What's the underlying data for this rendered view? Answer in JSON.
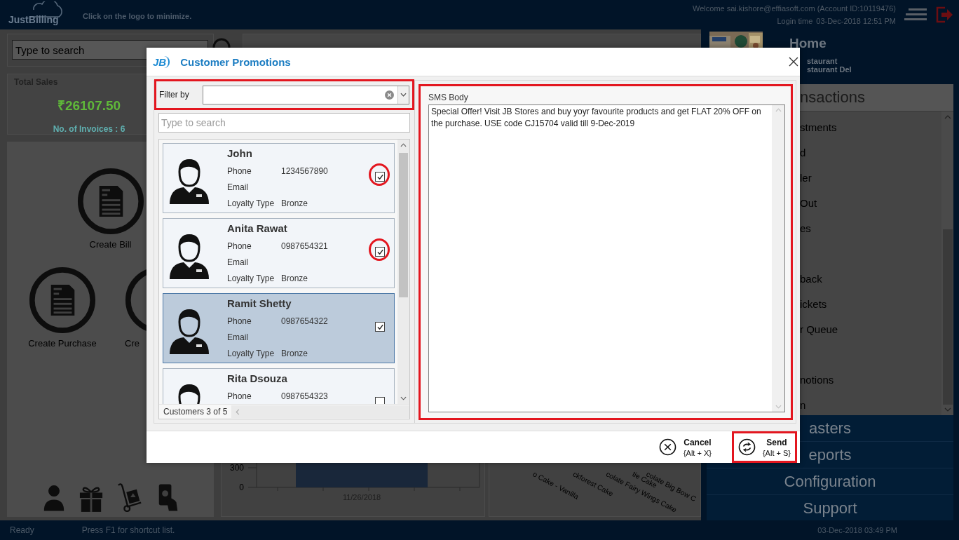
{
  "header": {
    "logo": "JustBilling",
    "hint": "Click on the logo to minimize.",
    "welcome": "Welcome sai.kishore@effiasoft.com (Account ID:10119476)",
    "login_label": "Login time",
    "login_time": "03-Dec-2018 12:51 PM"
  },
  "left_panel": {
    "search": {
      "placeholder": "Type to search"
    },
    "total_sales": {
      "title": "Total Sales",
      "amount": "₹26107.50",
      "invoices": "No. of Invoices : 6"
    },
    "actions": [
      {
        "label": "Create Bill"
      },
      {
        "label": "Create Purchase"
      },
      {
        "label": "Cre"
      }
    ]
  },
  "chart_fragment": {
    "ticks": [
      "300",
      "0"
    ],
    "category": "11/26/2018"
  },
  "product_labels": [
    "o Cake - Vanilla",
    "ckforest Cake",
    "colate Fairy Wings Cake",
    "tie Cake",
    "colate Big Bow C"
  ],
  "sidebar": {
    "home": "Home",
    "outlets": [
      "staurant",
      "staurant Del"
    ],
    "section": "nsactions",
    "items": [
      {
        "kind": "item",
        "label": "stments"
      },
      {
        "kind": "item",
        "label": "d"
      },
      {
        "kind": "item",
        "label": "ler"
      },
      {
        "kind": "item",
        "label": "Out"
      },
      {
        "kind": "item",
        "label": "es"
      },
      {
        "kind": "covered"
      },
      {
        "kind": "item",
        "label": "back"
      },
      {
        "kind": "item",
        "label": "ickets"
      },
      {
        "kind": "item",
        "label": "r Queue"
      },
      {
        "kind": "covered"
      },
      {
        "kind": "item",
        "label": "notions"
      },
      {
        "kind": "item",
        "label": "n"
      }
    ],
    "menus": [
      "asters",
      "eports",
      "Configuration",
      "Support"
    ]
  },
  "modal": {
    "logo": "JB",
    "title": "Customer Promotions",
    "filter": {
      "label": "Filter by",
      "highlighted": true
    },
    "search": {
      "placeholder": "Type to search"
    },
    "customers": [
      {
        "name": "John",
        "phone_label": "Phone",
        "phone": "1234567890",
        "email_label": "Email",
        "loyalty_label": "Loyalty Type",
        "loyalty": "Bronze",
        "checked": true,
        "selected": false,
        "highlighted": true
      },
      {
        "name": "Anita Rawat",
        "phone_label": "Phone",
        "phone": "0987654321",
        "email_label": "Email",
        "loyalty_label": "Loyalty Type",
        "loyalty": "Bronze",
        "checked": true,
        "selected": false,
        "highlighted": true
      },
      {
        "name": "Ramit Shetty",
        "phone_label": "Phone",
        "phone": "0987654322",
        "email_label": "Email",
        "loyalty_label": "Loyalty Type",
        "loyalty": "Bronze",
        "checked": true,
        "selected": true,
        "highlighted": false
      },
      {
        "name": "Rita Dsouza",
        "phone_label": "Phone",
        "phone": "0987654323",
        "checked": false,
        "selected": false,
        "highlighted": false
      }
    ],
    "count": "Customers 3 of 5",
    "sms": {
      "label": "SMS Body",
      "text": "Special Offer! Visit JB Stores and buy yoyr favourite products and get FLAT 20% OFF on the purchase. USE code CJ15704 valid till 9-Dec-2019",
      "highlighted": true
    },
    "buttons": [
      {
        "kind": "cancel",
        "label": "Cancel",
        "shortcut": "{Alt + X}",
        "highlighted": false
      },
      {
        "kind": "send",
        "label": "Send",
        "shortcut": "{Alt + S}",
        "highlighted": true
      }
    ]
  },
  "status_bar": {
    "state": "Ready",
    "hint": "Press F1 for shortcut list.",
    "time": "03-Dec-2018 03:49 PM"
  }
}
